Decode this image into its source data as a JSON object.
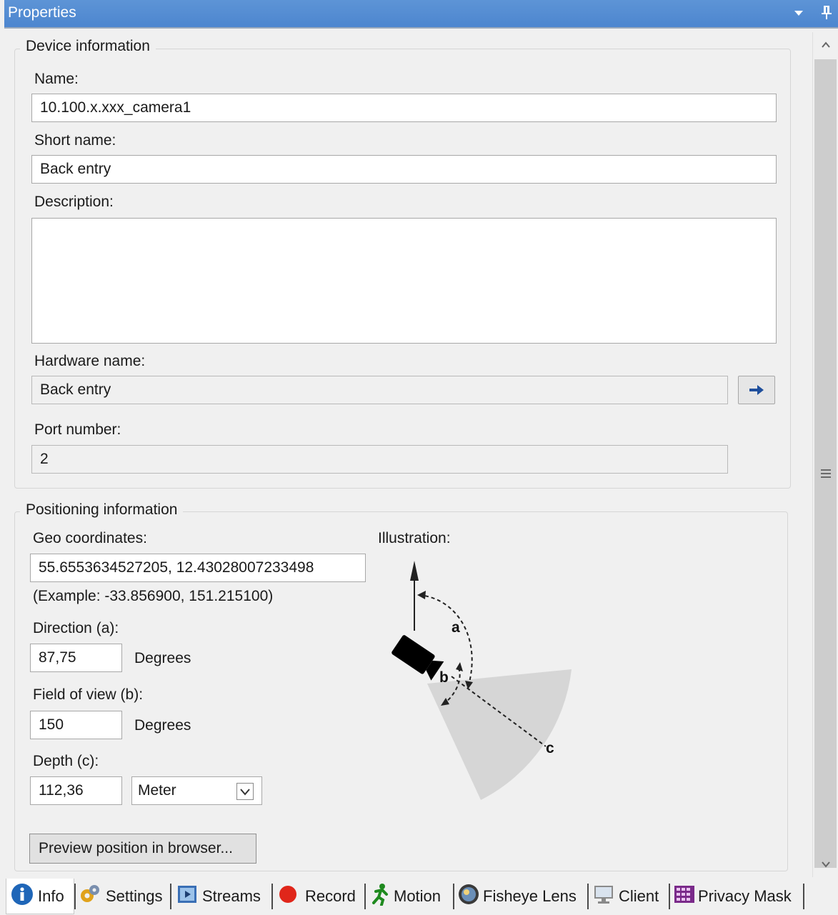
{
  "window": {
    "title": "Properties",
    "dropdown_icon": "dropdown-arrow-icon",
    "pin_icon": "pin-icon"
  },
  "device_info": {
    "legend": "Device information",
    "name_label": "Name:",
    "name_value": "10.100.x.xxx_camera1",
    "short_name_label": "Short name:",
    "short_name_value": "Back entry",
    "description_label": "Description:",
    "description_value": "",
    "hardware_name_label": "Hardware name:",
    "hardware_name_value": "Back entry",
    "port_number_label": "Port number:",
    "port_number_value": "2"
  },
  "positioning": {
    "legend": "Positioning information",
    "geo_label": "Geo coordinates:",
    "geo_value": "55.6553634527205, 12.43028007233498",
    "example_text": "(Example: -33.856900, 151.215100)",
    "direction_label": "Direction (a):",
    "direction_value": "87,75",
    "direction_unit": "Degrees",
    "fov_label": "Field of view (b):",
    "fov_value": "150",
    "fov_unit": "Degrees",
    "depth_label": "Depth (c):",
    "depth_value": "112,36",
    "depth_unit": "Meter",
    "illustration_label": "Illustration:",
    "illustration_letters": {
      "a": "a",
      "b": "b",
      "c": "c"
    },
    "preview_button": "Preview position in browser..."
  },
  "tabs": [
    {
      "label": "Info",
      "icon": "info-icon",
      "active": true
    },
    {
      "label": "Settings",
      "icon": "settings-icon",
      "active": false
    },
    {
      "label": "Streams",
      "icon": "streams-icon",
      "active": false
    },
    {
      "label": "Record",
      "icon": "record-icon",
      "active": false
    },
    {
      "label": "Motion",
      "icon": "motion-icon",
      "active": false
    },
    {
      "label": "Fisheye Lens",
      "icon": "fisheye-lens-icon",
      "active": false
    },
    {
      "label": "Client",
      "icon": "client-icon",
      "active": false
    },
    {
      "label": "Privacy Mask",
      "icon": "privacy-mask-icon",
      "active": false
    }
  ],
  "colors": {
    "titlebar": "#4f88d0",
    "accent_arrow": "#1f4f9c",
    "record": "#e0261a",
    "motion": "#1f8a1f"
  }
}
